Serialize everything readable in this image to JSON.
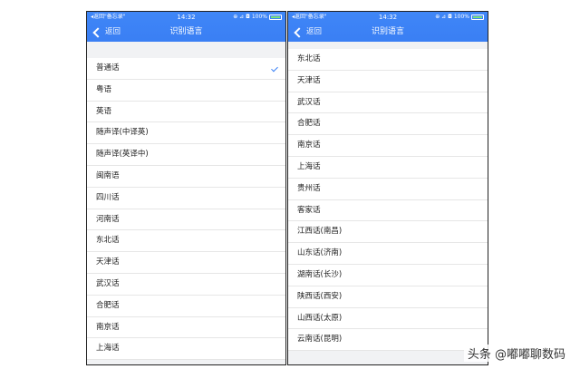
{
  "status": {
    "carrier": "◂返回\"备忘录\" ",
    "time": "14:32",
    "icons": "⊕ ⊿ ◘",
    "battery": "100%"
  },
  "navbar": {
    "back_label": "返回",
    "title": "识别语言"
  },
  "left_list": [
    "普通话",
    "粤语",
    "英语",
    "随声译(中译英)",
    "随声译(英译中)",
    "闽南语",
    "四川话",
    "河南话",
    "东北话",
    "天津话",
    "武汉话",
    "合肥话",
    "南京话",
    "上海话"
  ],
  "right_list": [
    "东北话",
    "天津话",
    "武汉话",
    "合肥话",
    "南京话",
    "上海话",
    "贵州话",
    "客家话",
    "江西话(南昌)",
    "山东话(济南)",
    "湖南话(长沙)",
    "陕西话(西安)",
    "山西话(太原)",
    "云南话(昆明)"
  ],
  "selected": "普通话",
  "watermark": "头条 @嘟嘟聊数码",
  "colors": {
    "header": "#3b82f6",
    "check": "#3b82f6"
  }
}
